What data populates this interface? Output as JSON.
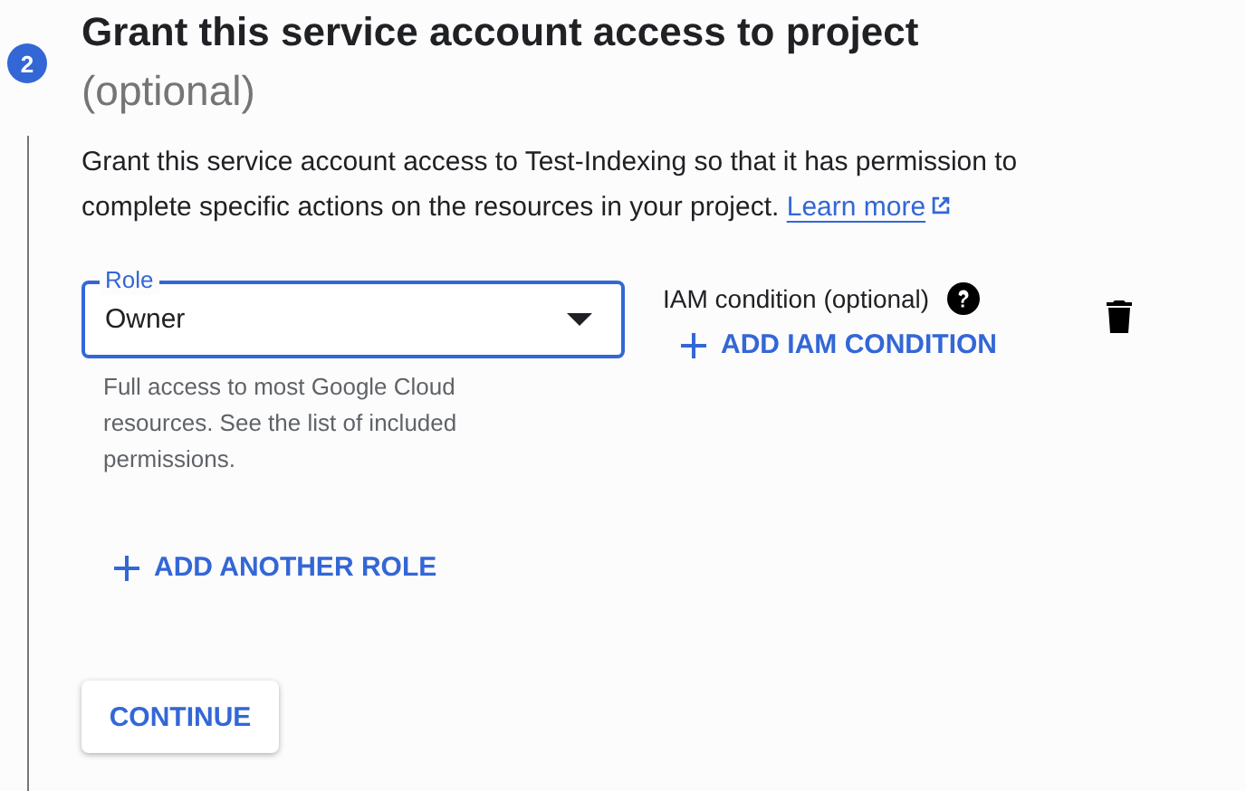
{
  "step": {
    "number": "2",
    "title": "Grant this service account access to project",
    "title_suffix": "(optional)"
  },
  "description": {
    "text": "Grant this service account access to Test-Indexing so that it has permission to complete specific actions on the resources in your project.",
    "link": "Learn more"
  },
  "role": {
    "label": "Role",
    "value": "Owner",
    "focused": true,
    "helper": "Full access to most Google Cloud resources. See the list of included permissions."
  },
  "iam_condition": {
    "label": "IAM condition (optional)",
    "button": "ADD IAM CONDITION"
  },
  "add_role_button": "ADD ANOTHER ROLE",
  "continue_button": "CONTINUE"
}
